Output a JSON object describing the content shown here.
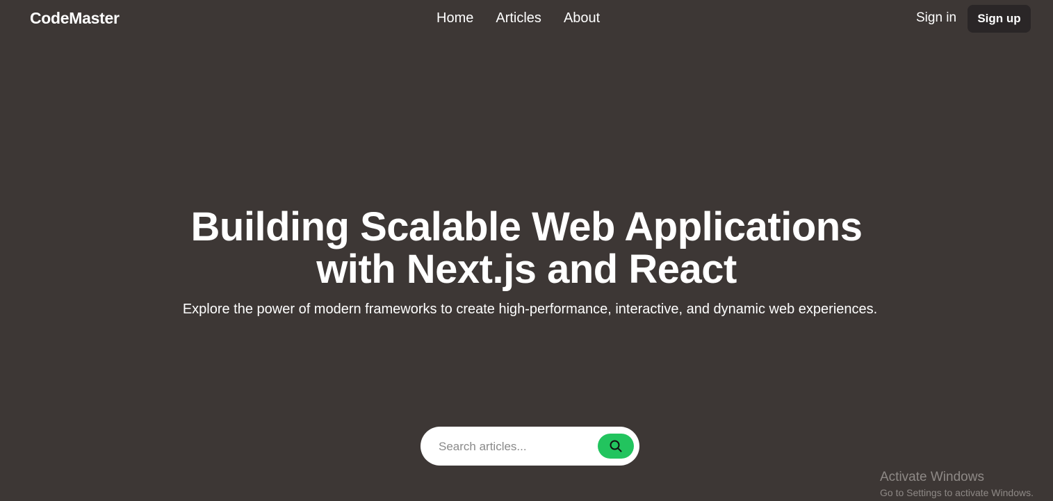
{
  "header": {
    "logo": "CodeMaster",
    "nav": [
      {
        "label": "Home"
      },
      {
        "label": "Articles"
      },
      {
        "label": "About"
      }
    ],
    "sign_in": "Sign in",
    "sign_up": "Sign up"
  },
  "hero": {
    "title_line1": "Building Scalable Web Applications",
    "title_line2": "with Next.js and React",
    "subtitle": "Explore the power of modern frameworks to create high-performance, interactive, and dynamic web experiences."
  },
  "search": {
    "placeholder": "Search articles...",
    "value": "",
    "button_icon": "search-icon"
  },
  "watermark": {
    "title": "Activate Windows",
    "subtitle": "Go to Settings to activate Windows."
  },
  "colors": {
    "background": "#3d3735",
    "accent": "#22c45e",
    "sign_up_bg": "#2a2627"
  }
}
